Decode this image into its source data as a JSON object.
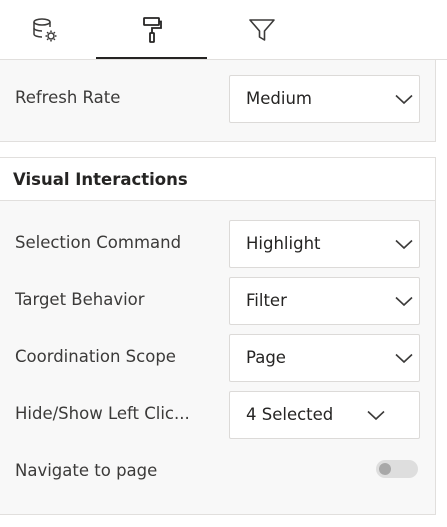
{
  "tabs": [
    {
      "id": "data",
      "icon": "database-gear-icon"
    },
    {
      "id": "format",
      "icon": "paint-roller-icon",
      "active": true
    },
    {
      "id": "filter",
      "icon": "filter-icon"
    }
  ],
  "refresh": {
    "label": "Refresh Rate",
    "value": "Medium"
  },
  "visual_interactions": {
    "title": "Visual Interactions",
    "selection_command": {
      "label": "Selection Command",
      "value": "Highlight"
    },
    "target_behavior": {
      "label": "Target Behavior",
      "value": "Filter"
    },
    "coordination_scope": {
      "label": "Coordination Scope",
      "value": "Page"
    },
    "hide_show_left_click": {
      "label": "Hide/Show Left Clic...",
      "value": "4 Selected"
    },
    "navigate_to_page": {
      "label": "Navigate to page",
      "enabled": false
    }
  },
  "colors": {
    "accent": "#252423",
    "panel_bg": "#f8f8f8",
    "border": "#e1dfdd",
    "toggle_off": "#dedede"
  }
}
